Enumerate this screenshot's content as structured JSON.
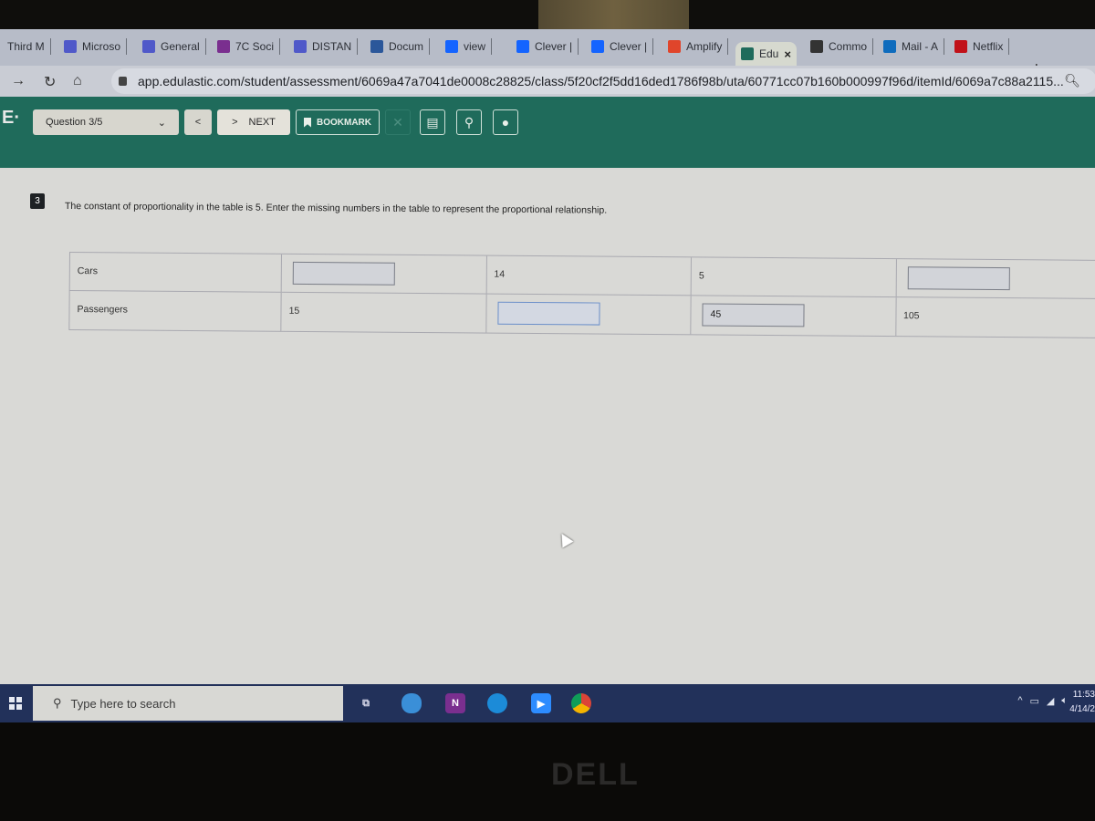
{
  "browser": {
    "tabs": [
      {
        "label": "Third M",
        "icon": "none",
        "color": ""
      },
      {
        "label": "Microso",
        "icon": "teams-icon",
        "color": "#5059c9"
      },
      {
        "label": "General",
        "icon": "teams-icon",
        "color": "#5059c9"
      },
      {
        "label": "7C Soci",
        "icon": "onenote-icon",
        "color": "#7a2f8f"
      },
      {
        "label": "DISTAN",
        "icon": "teams-icon",
        "color": "#5059c9"
      },
      {
        "label": "Docum",
        "icon": "word-icon",
        "color": "#2b579a"
      },
      {
        "label": "view",
        "icon": "clever-icon",
        "color": "#1464ff"
      },
      {
        "label": "Clever |",
        "icon": "clever-icon",
        "color": "#1464ff"
      },
      {
        "label": "Clever |",
        "icon": "clever-icon",
        "color": "#1464ff"
      },
      {
        "label": "Amplify",
        "icon": "amplify-icon",
        "color": "#e0452b"
      },
      {
        "label": "Edu",
        "icon": "edulastic-icon",
        "color": "#1f6b5b",
        "active": true
      },
      {
        "label": "Commo",
        "icon": "book-icon",
        "color": "#333"
      },
      {
        "label": "Mail - A",
        "icon": "outlook-icon",
        "color": "#0f6cbd"
      },
      {
        "label": "Netflix",
        "icon": "netflix-icon",
        "color": "#c11119"
      }
    ],
    "new_tab": "+",
    "url": "app.edulastic.com/student/assessment/6069a47a7041de0008c28825/class/5f20cf2f5dd16ded1786f98b/uta/60771cc07b160b000997f96d/itemId/6069a7c88a2115..."
  },
  "header": {
    "logo": "E·",
    "question_select": "Question 3/5",
    "prev_label": "<",
    "next_label": "NEXT",
    "bookmark_label": "BOOKMARK",
    "accent": "#1f6b5b"
  },
  "question": {
    "number": "3",
    "text": "The constant of proportionality in the table is 5. Enter the missing numbers in the table to represent the proportional relationship.",
    "table": {
      "rows": [
        {
          "label": "Cars",
          "cells": [
            {
              "type": "input",
              "value": ""
            },
            {
              "type": "text",
              "value": "14"
            },
            {
              "type": "text",
              "value": "5"
            },
            {
              "type": "input",
              "value": ""
            }
          ]
        },
        {
          "label": "Passengers",
          "cells": [
            {
              "type": "text",
              "value": "15"
            },
            {
              "type": "input",
              "value": ""
            },
            {
              "type": "input",
              "value": "45"
            },
            {
              "type": "text",
              "value": "105"
            }
          ]
        }
      ]
    }
  },
  "taskbar": {
    "search_placeholder": "Type here to search",
    "time": "11:53",
    "date": "4/14/2"
  },
  "bezel": {
    "brand": "DELL"
  }
}
